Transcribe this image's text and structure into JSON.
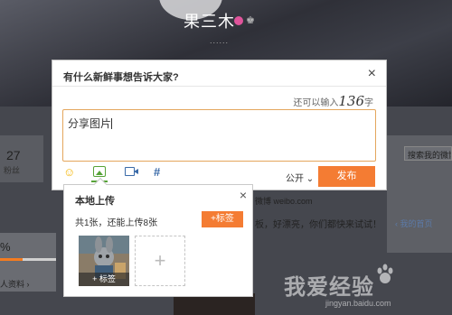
{
  "profile": {
    "username": "果三木",
    "dots": "......",
    "stat_number": "27",
    "stat_label": "粉丝",
    "completion_percent": "%",
    "profile_link": "人资料 ›",
    "search_my_weibo": "搜索我的微博",
    "feed_text_1": "微博 weibo.com",
    "feed_text_2": "板，好漂亮，你们都快来试试！",
    "my_post_link": "我的首页"
  },
  "dialog": {
    "title": "有什么新鲜事想告诉大家?",
    "count_prefix": "还可以输入",
    "count_number": "136",
    "count_suffix": "字",
    "composer_text": "分享图片",
    "visibility": "公开 ⌄",
    "publish_label": "发布"
  },
  "upload": {
    "title": "本地上传",
    "info": "共1张，还能上传8张",
    "tag_button": "+标签",
    "thumb_tag": "+ 标签",
    "add_slot": "+"
  },
  "watermark": {
    "main": "我爱经验",
    "sub": "jingyan.baidu.com"
  },
  "colors": {
    "accent_orange": "#f47c33",
    "composer_border": "#e4a65d",
    "image_tool_green": "#57a338",
    "link_blue": "#3a6aa8"
  }
}
